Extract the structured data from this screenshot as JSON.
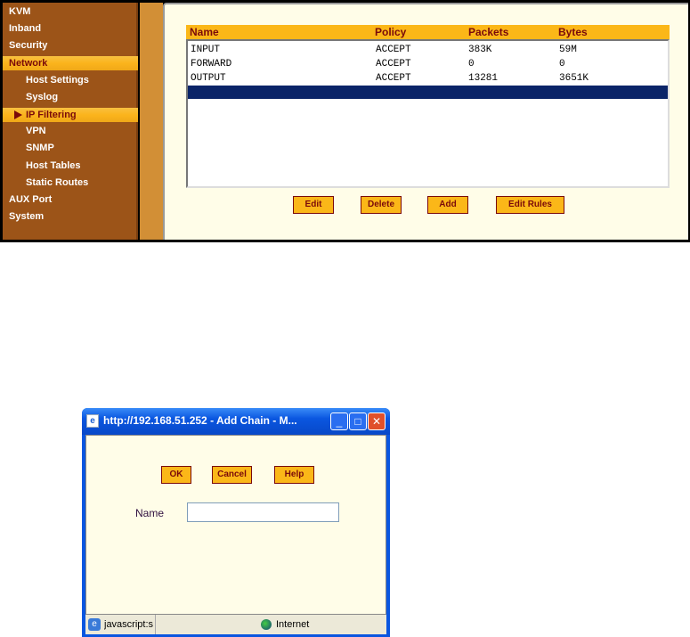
{
  "sidebar": {
    "items": [
      "KVM",
      "Inband",
      "Security",
      "Network",
      "Host Settings",
      "Syslog",
      "IP Filtering",
      "VPN",
      "SNMP",
      "Host Tables",
      "Static Routes",
      "AUX Port",
      "System"
    ]
  },
  "table": {
    "headers": [
      "Name",
      "Policy",
      "Packets",
      "Bytes"
    ],
    "rows": [
      [
        "INPUT",
        "ACCEPT",
        "383K",
        "59M"
      ],
      [
        "FORWARD",
        "ACCEPT",
        "0",
        "0"
      ],
      [
        "OUTPUT",
        "ACCEPT",
        "13281",
        "3651K"
      ]
    ]
  },
  "buttons": {
    "edit": "Edit",
    "delete": "Delete",
    "add": "Add",
    "edit_rules": "Edit Rules"
  },
  "dialog": {
    "title": "http://192.168.51.252 - Add Chain - M...",
    "ok": "OK",
    "cancel": "Cancel",
    "help": "Help",
    "name_label": "Name",
    "name_value": "",
    "status": "javascript:s",
    "zone": "Internet"
  }
}
